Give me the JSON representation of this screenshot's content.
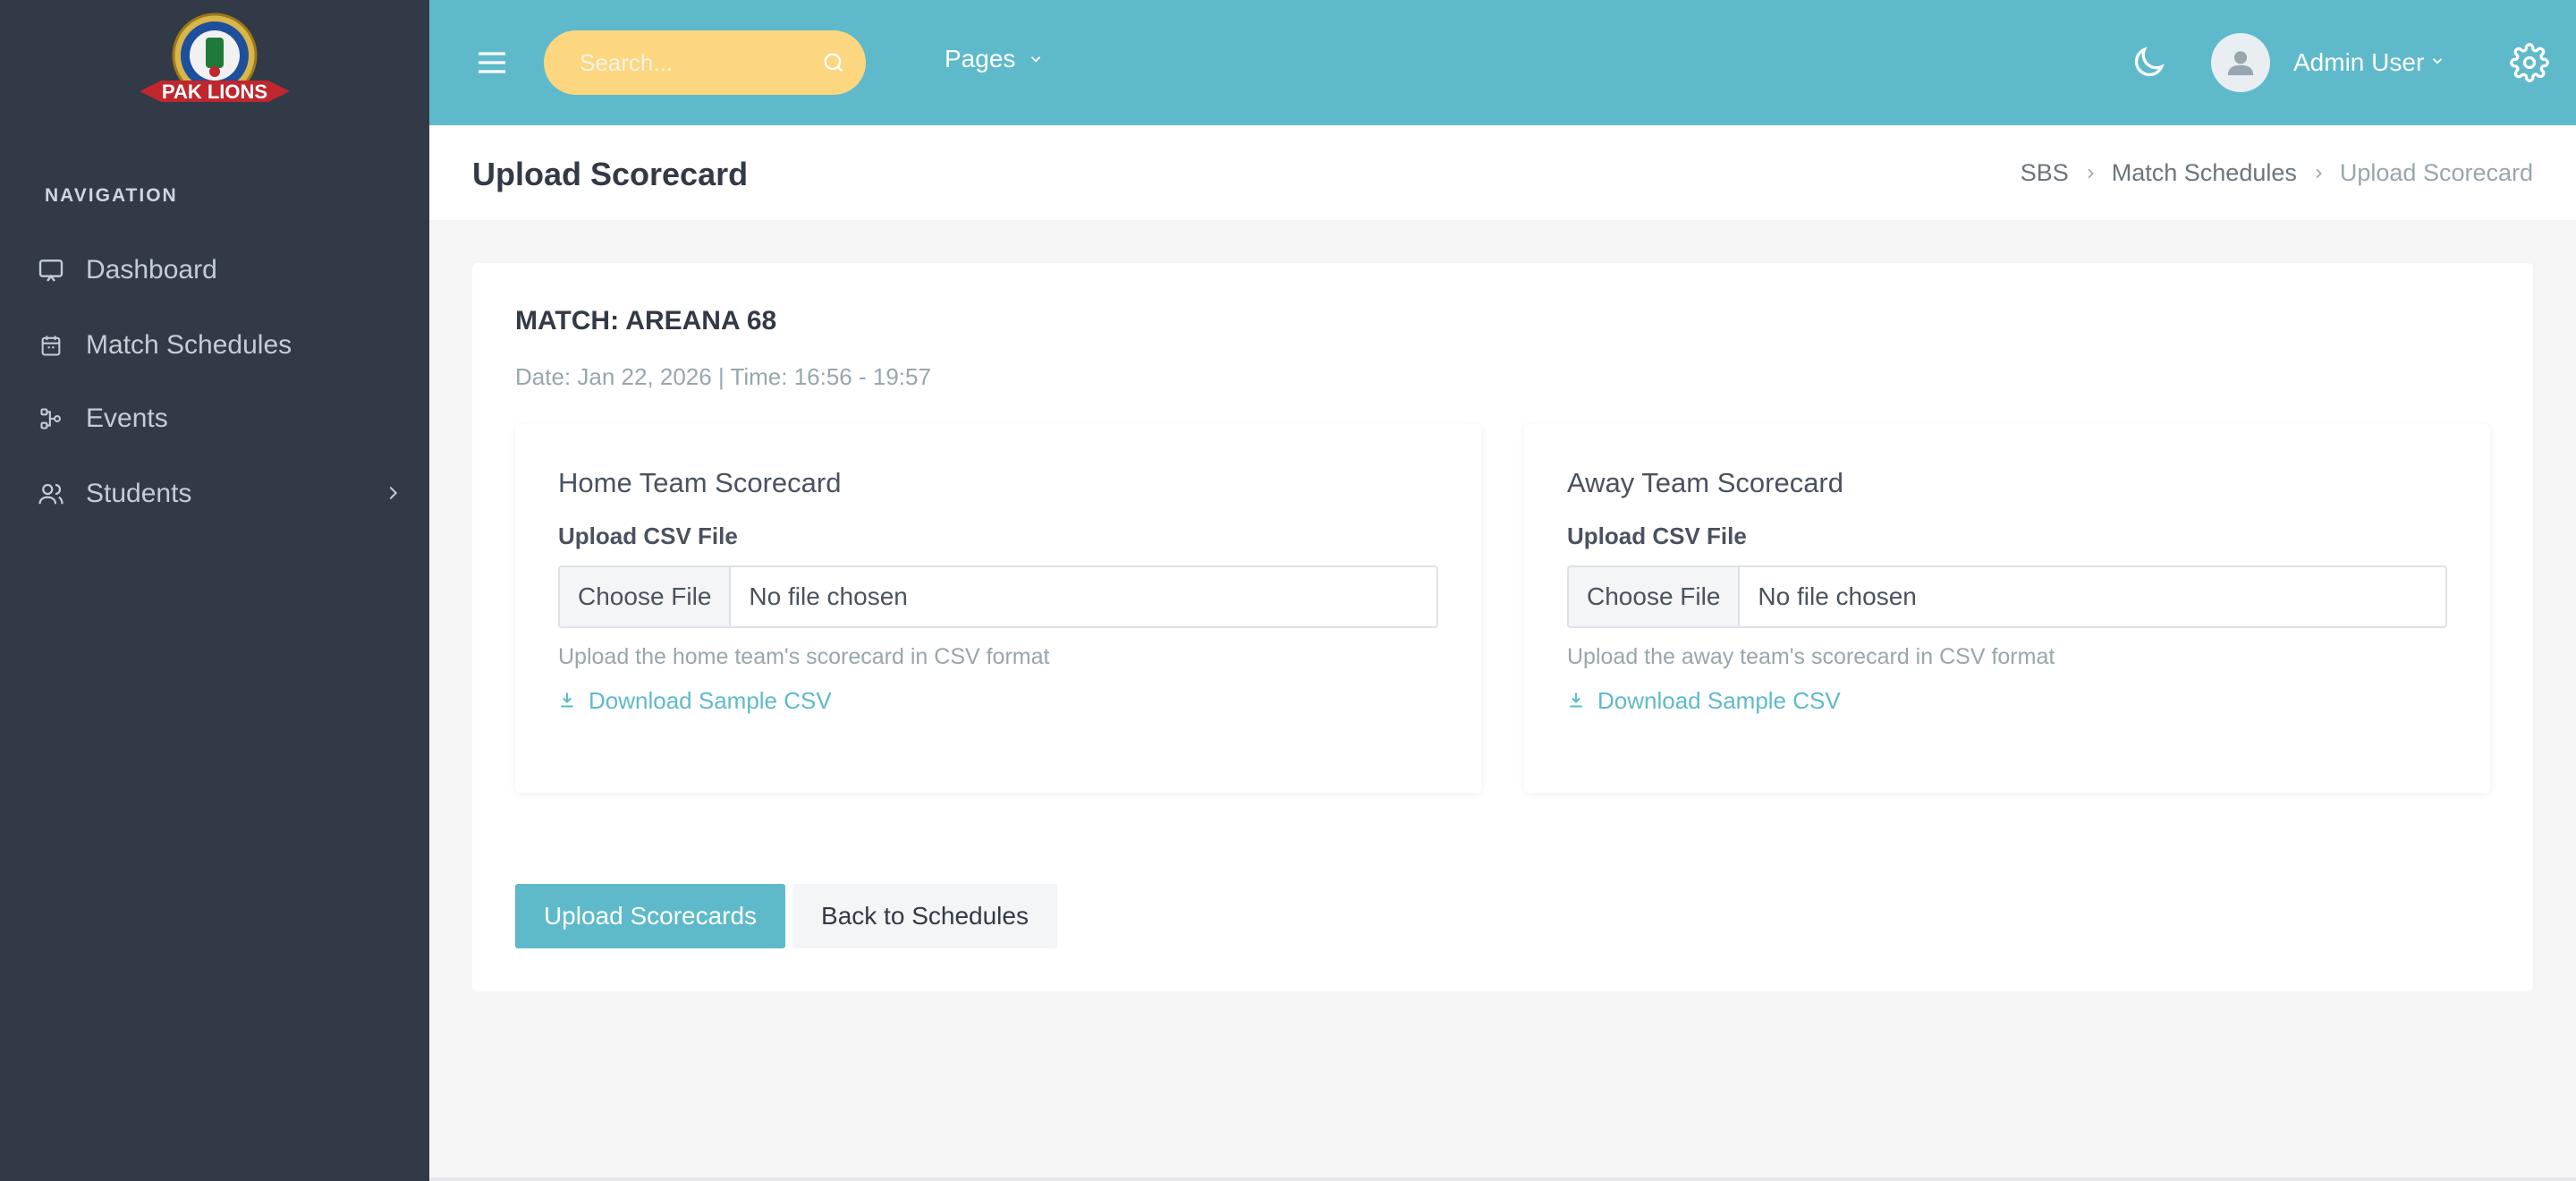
{
  "sidebar": {
    "logo_text": "PAK LIONS",
    "nav_title": "NAVIGATION",
    "items": [
      {
        "label": "Dashboard",
        "icon": "monitor-icon"
      },
      {
        "label": "Match Schedules",
        "icon": "calendar-icon"
      },
      {
        "label": "Events",
        "icon": "workflow-icon"
      },
      {
        "label": "Students",
        "icon": "users-icon"
      }
    ]
  },
  "topbar": {
    "search_placeholder": "Search...",
    "pages_label": "Pages",
    "user_name": "Admin User"
  },
  "titlebar": {
    "title": "Upload Scorecard",
    "breadcrumb": [
      "SBS",
      "Match Schedules",
      "Upload Scorecard"
    ]
  },
  "match": {
    "title": "MATCH: AREANA 68",
    "meta": "Date: Jan 22, 2026 | Time: 16:56 - 19:57"
  },
  "home": {
    "title": "Home Team Scorecard",
    "upload_label": "Upload CSV File",
    "choose_label": "Choose File",
    "file_status": "No file chosen",
    "help": "Upload the home team's scorecard in CSV format",
    "download": "Download Sample CSV"
  },
  "away": {
    "title": "Away Team Scorecard",
    "upload_label": "Upload CSV File",
    "choose_label": "Choose File",
    "file_status": "No file chosen",
    "help": "Upload the away team's scorecard in CSV format",
    "download": "Download Sample CSV"
  },
  "actions": {
    "upload": "Upload Scorecards",
    "back": "Back to Schedules"
  },
  "colors": {
    "topbar": "#5ebacb",
    "sidebar": "#313a46",
    "search": "#fdd77f",
    "accent": "#5ebacb"
  }
}
